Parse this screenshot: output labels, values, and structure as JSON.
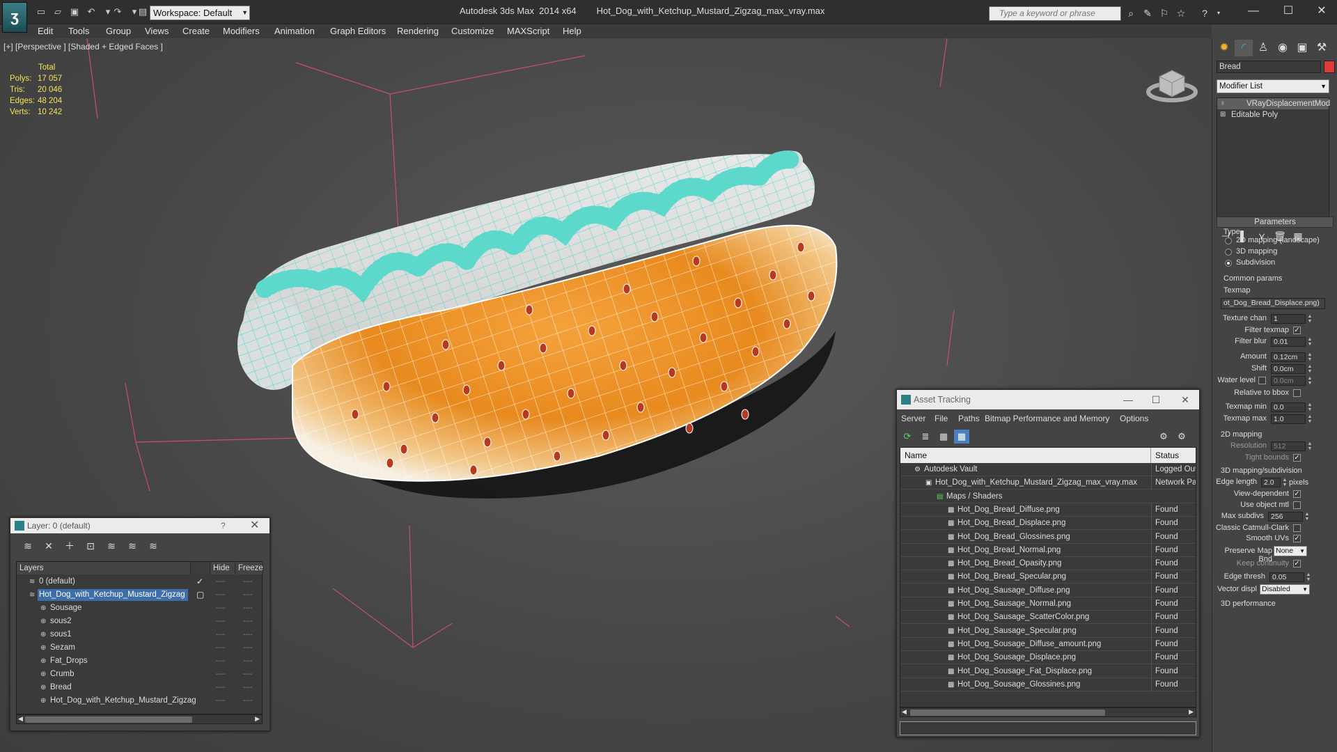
{
  "app": {
    "name": "Autodesk 3ds Max  2014 x64",
    "file": "Hot_Dog_with_Ketchup_Mustard_Zigzag_max_vray.max",
    "workspace": "Workspace: Default",
    "search_placeholder": "Type a keyword or phrase"
  },
  "menu": [
    "Edit",
    "Tools",
    "Group",
    "Views",
    "Create",
    "Modifiers",
    "Animation",
    "Graph Editors",
    "Rendering",
    "Customize",
    "MAXScript",
    "Help"
  ],
  "viewport": {
    "label": "[+] [Perspective ] [Shaded + Edged Faces ]",
    "stats": {
      "header": "Total",
      "rows": [
        {
          "label": "Polys:",
          "value": "17 057"
        },
        {
          "label": "Tris:",
          "value": "20 046"
        },
        {
          "label": "Edges:",
          "value": "48 204"
        },
        {
          "label": "Verts:",
          "value": "10 242"
        }
      ]
    }
  },
  "command_panel": {
    "object_name": "Bread",
    "object_color": "#e03b3b",
    "modifier_list": "Modifier List",
    "stack": [
      "VRayDisplacementMod",
      "Editable Poly"
    ],
    "parameters_title": "Parameters",
    "type_label": "Type",
    "type_options": [
      "2D mapping (landscape)",
      "3D mapping",
      "Subdivision"
    ],
    "type_selected": 2,
    "common_params": "Common params",
    "texmap_label": "Texmap",
    "texmap_value": "ot_Dog_Bread_Displace.png)",
    "texture_chan_label": "Texture chan",
    "texture_chan": "1",
    "filter_texmap_label": "Filter texmap",
    "filter_blur_label": "Filter blur",
    "filter_blur": "0.01",
    "amount_label": "Amount",
    "amount": "0.12cm",
    "shift_label": "Shift",
    "shift": "0.0cm",
    "water_level_label": "Water level",
    "water_level": "0.0cm",
    "relative_bbox_label": "Relative to bbox",
    "texmap_min_label": "Texmap min",
    "texmap_min": "0.0",
    "texmap_max_label": "Texmap max",
    "texmap_max": "1.0",
    "mapping2d_group": "2D mapping",
    "resolution_label": "Resolution",
    "resolution": "512",
    "tight_bounds_label": "Tight bounds",
    "mapping3d_group": "3D mapping/subdivision",
    "edge_length_label": "Edge length",
    "edge_length": "2.0",
    "pixels_label": "pixels",
    "view_dependent_label": "View-dependent",
    "use_object_mtl_label": "Use object mtl",
    "max_subdivs_label": "Max subdivs",
    "max_subdivs": "256",
    "catmull_label": "Classic Catmull-Clark",
    "smooth_uvs_label": "Smooth UVs",
    "preserve_map_label": "Preserve Map Bnd",
    "preserve_map": "None",
    "keep_continuity_label": "Keep continuity",
    "edge_thresh_label": "Edge thresh",
    "edge_thresh": "0.05",
    "vector_displ_label": "Vector displ",
    "vector_displ": "Disabled",
    "perf_group": "3D performance"
  },
  "layer_dialog": {
    "title": "Layer: 0 (default)",
    "help": "?",
    "col_layers": "Layers",
    "col_hide": "Hide",
    "col_freeze": "Freeze",
    "rows": [
      {
        "name": "0 (default)",
        "indent": 1,
        "check": true,
        "selected": false
      },
      {
        "name": "Hot_Dog_with_Ketchup_Mustard_Zigzag",
        "indent": 1,
        "check": false,
        "selected": true
      },
      {
        "name": "Sousage",
        "indent": 2,
        "check": false,
        "selected": false
      },
      {
        "name": "sous2",
        "indent": 2,
        "check": false,
        "selected": false
      },
      {
        "name": "sous1",
        "indent": 2,
        "check": false,
        "selected": false
      },
      {
        "name": "Sezam",
        "indent": 2,
        "check": false,
        "selected": false
      },
      {
        "name": "Fat_Drops",
        "indent": 2,
        "check": false,
        "selected": false
      },
      {
        "name": "Crumb",
        "indent": 2,
        "check": false,
        "selected": false
      },
      {
        "name": "Bread",
        "indent": 2,
        "check": false,
        "selected": false
      },
      {
        "name": "Hot_Dog_with_Ketchup_Mustard_Zigzag",
        "indent": 2,
        "check": false,
        "selected": false
      }
    ]
  },
  "asset_tracking": {
    "title": "Asset Tracking",
    "menu": [
      "Server",
      "File",
      "Paths",
      "Bitmap Performance and Memory",
      "Options"
    ],
    "col_name": "Name",
    "col_status": "Status",
    "rows": [
      {
        "name": "Autodesk Vault",
        "status": "Logged Out",
        "indent": 1,
        "icon": "vault"
      },
      {
        "name": "Hot_Dog_with_Ketchup_Mustard_Zigzag_max_vray.max",
        "status": "Network Pat",
        "indent": 2,
        "icon": "max"
      },
      {
        "name": "Maps / Shaders",
        "status": "",
        "indent": 3,
        "icon": "maps"
      },
      {
        "name": "Hot_Dog_Bread_Diffuse.png",
        "status": "Found",
        "indent": 4,
        "icon": "bitmap"
      },
      {
        "name": "Hot_Dog_Bread_Displace.png",
        "status": "Found",
        "indent": 4,
        "icon": "bitmap"
      },
      {
        "name": "Hot_Dog_Bread_Glossines.png",
        "status": "Found",
        "indent": 4,
        "icon": "bitmap"
      },
      {
        "name": "Hot_Dog_Bread_Normal.png",
        "status": "Found",
        "indent": 4,
        "icon": "bitmap"
      },
      {
        "name": "Hot_Dog_Bread_Opasity.png",
        "status": "Found",
        "indent": 4,
        "icon": "bitmap"
      },
      {
        "name": "Hot_Dog_Bread_Specular.png",
        "status": "Found",
        "indent": 4,
        "icon": "bitmap"
      },
      {
        "name": "Hot_Dog_Sausage_Diffuse.png",
        "status": "Found",
        "indent": 4,
        "icon": "bitmap"
      },
      {
        "name": "Hot_Dog_Sausage_Normal.png",
        "status": "Found",
        "indent": 4,
        "icon": "bitmap"
      },
      {
        "name": "Hot_Dog_Sausage_ScatterColor.png",
        "status": "Found",
        "indent": 4,
        "icon": "bitmap"
      },
      {
        "name": "Hot_Dog_Sausage_Specular.png",
        "status": "Found",
        "indent": 4,
        "icon": "bitmap"
      },
      {
        "name": "Hot_Dog_Sousage_Diffuse_amount.png",
        "status": "Found",
        "indent": 4,
        "icon": "bitmap"
      },
      {
        "name": "Hot_Dog_Sousage_Displace.png",
        "status": "Found",
        "indent": 4,
        "icon": "bitmap"
      },
      {
        "name": "Hot_Dog_Sousage_Fat_Displace.png",
        "status": "Found",
        "indent": 4,
        "icon": "bitmap"
      },
      {
        "name": "Hot_Dog_Sousage_Glossines.png",
        "status": "Found",
        "indent": 4,
        "icon": "bitmap"
      }
    ]
  }
}
